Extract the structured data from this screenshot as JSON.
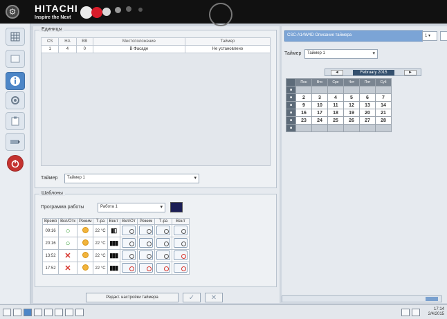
{
  "header": {
    "brand": "HITACHI",
    "tagline": "Inspire the Next"
  },
  "sidebar": {
    "icons": [
      "grid-icon",
      "list-icon",
      "info-icon",
      "settings-icon",
      "clipboard-icon",
      "edit-icon",
      "power-icon"
    ]
  },
  "units": {
    "title": "Единицы",
    "columns": [
      "СS",
      "НА",
      "ВВ",
      "Местоположение",
      "Таймер"
    ],
    "rows": [
      [
        "1",
        "4",
        "0",
        "В Фасаде",
        "Не установлено"
      ]
    ],
    "timer_label": "Таймер",
    "timer_value": "Таймер 1"
  },
  "patterns": {
    "title": "Шаблоны",
    "program_label": "Программа работы",
    "program_value": "Работа 1",
    "columns": [
      "Время",
      "Вкл/Отк",
      "Режим",
      "Т-ра",
      "Вент",
      "Вкл/От",
      "Режим",
      "Т-ра",
      "Вент"
    ],
    "rows": [
      {
        "time": "09:16",
        "state": "on",
        "temp": "22 °C"
      },
      {
        "time": "20:16",
        "state": "on",
        "temp": "22 °C"
      },
      {
        "time": "13:52",
        "state": "off",
        "temp": "22 °C"
      },
      {
        "time": "17:52",
        "state": "off",
        "temp": "22 °C"
      }
    ]
  },
  "footer": {
    "edit_button": "Редакт. настройки таймера",
    "ok_symbol": "✓",
    "cancel_symbol": "✕"
  },
  "calendar": {
    "header": "CSC-A14W4D Описание таймера",
    "timer_label": "Таймер",
    "timer_value": "Таймер 1",
    "month": "February 2015",
    "prev": "◄",
    "next": "►",
    "weekdays": [
      "Пон",
      "Вто",
      "Сре",
      "Чет",
      "Пят",
      "Суб"
    ],
    "weeks": [
      [
        "",
        "",
        "",
        "",
        "",
        ""
      ],
      [
        "2",
        "3",
        "4",
        "5",
        "6",
        "7"
      ],
      [
        "9",
        "10",
        "11",
        "12",
        "13",
        "14"
      ],
      [
        "16",
        "17",
        "18",
        "19",
        "20",
        "21"
      ],
      [
        "23",
        "24",
        "25",
        "26",
        "27",
        "28"
      ],
      [
        "",
        "",
        "",
        "",
        "",
        ""
      ]
    ],
    "combo_value": "1 ▾"
  },
  "clock": {
    "time": "17:14",
    "date": "2/4/2015"
  }
}
